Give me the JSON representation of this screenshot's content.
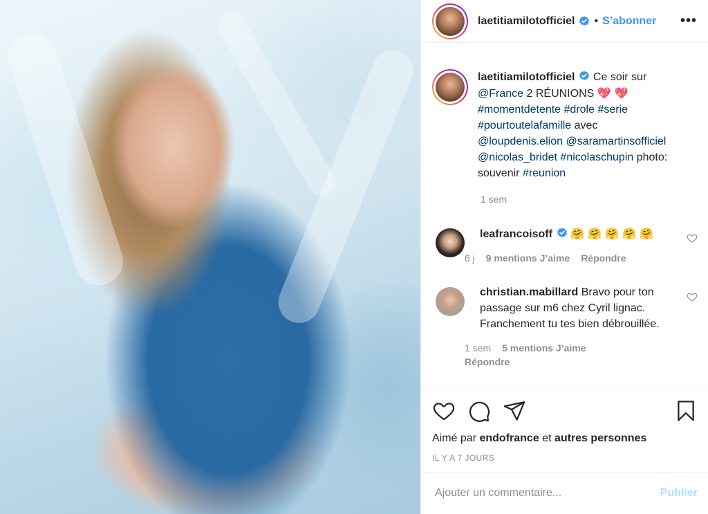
{
  "post": {
    "username": "laetitiamilotofficiel",
    "separator_dot": "•",
    "follow_label": "S’abonner",
    "more_label": "•••"
  },
  "caption": {
    "username": "laetitiamilotofficiel",
    "t1": " Ce soir sur ",
    "mention_france": "@France",
    "t2": " 2 RÉUNIONS ",
    "emoji_hearts": "💖 💖",
    "tags1": "#momentdetente #drole #serie",
    "tags2": "#pourtoutelafamille",
    "t3": " avec",
    "mentions1": "@loupdenis.elion @saramartinsofficiel",
    "mentions2": "@nicolas_bridet #nicolaschupin",
    "t4": " photo:",
    "t5": "souvenir ",
    "tag_reunion": "#reunion",
    "time": "1 sem"
  },
  "comments": [
    {
      "username": "leafrancoisoff",
      "text": "🤗 🤗 🤗 🤗 🤗",
      "time": "6 j",
      "likes": "9 mentions J’aime",
      "reply": "Répondre"
    },
    {
      "username": "christian.mabillard",
      "text": " Bravo pour ton passage sur m6 chez Cyril lignac. Franchement tu tes bien débrouillée.",
      "time": "1 sem",
      "likes": "5 mentions J’aime",
      "reply": "Répondre"
    }
  ],
  "likes": {
    "prefix": "Aimé par ",
    "user": "endofrance",
    "middle": " et ",
    "others": "autres personnes"
  },
  "time_ago": "IL Y A 7 JOURS",
  "add_comment": {
    "placeholder": "Ajouter un commentaire...",
    "publish_label": "Publier"
  },
  "colors": {
    "link": "#00376b",
    "follow": "#3897f0",
    "publish_disabled": "#b2dffc",
    "verified": "#3897f0"
  },
  "icons": [
    "verified-badge-icon",
    "heart-icon",
    "comment-icon",
    "share-icon",
    "bookmark-icon"
  ]
}
